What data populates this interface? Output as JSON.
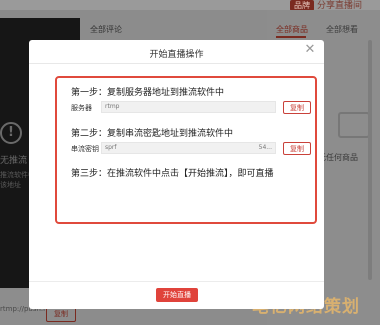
{
  "background": {
    "brand_badge": "品牌",
    "brand_text": "分享直播间",
    "comments_header": "全部评论",
    "tabs": [
      "全部商品",
      "全部想看"
    ],
    "no_stream_text": "无推流",
    "push_hint_lines": [
      "推流软件中，",
      "该地址"
    ],
    "no_goods_text": "无任何商品",
    "push_url_snippet": "rtmp://push.mom...",
    "copy_label": "复制",
    "watermark": "笔亿网络策划"
  },
  "modal": {
    "title": "开始直播操作",
    "close_icon": "close-icon",
    "step1": {
      "title": "第一步：复制服务器地址到推流软件中",
      "label": "服务器",
      "value": "rtmp",
      "copy_label": "复制"
    },
    "step2": {
      "title": "第二步：复制串流密匙地址到推流软件中",
      "label": "串流密钥",
      "value": "sprf",
      "value_end": "54...",
      "copy_label": "复制"
    },
    "step3": {
      "title": "第三步：在推流软件中点击【开始推流】，即可直播"
    },
    "start_button": "开始直播"
  },
  "colors": {
    "accent": "#e0433b",
    "highlight_border": "#e04a3c"
  }
}
